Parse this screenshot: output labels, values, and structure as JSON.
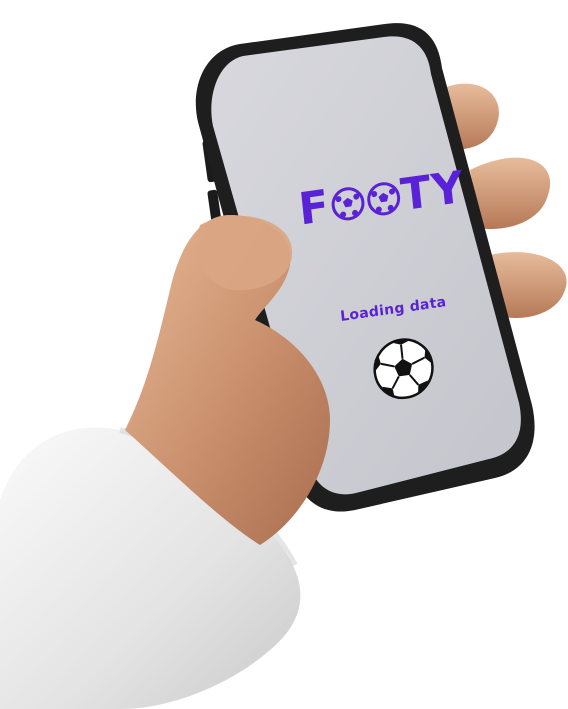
{
  "app": {
    "logo": {
      "letters_before": "F",
      "letters_after": "TY",
      "ball_count": 2,
      "color": "#5a22d6"
    },
    "status_text": "Loading data",
    "status_color": "#5a22d6",
    "loader_icon": "soccer-ball-icon",
    "screen_color": "#cfcfd6"
  }
}
